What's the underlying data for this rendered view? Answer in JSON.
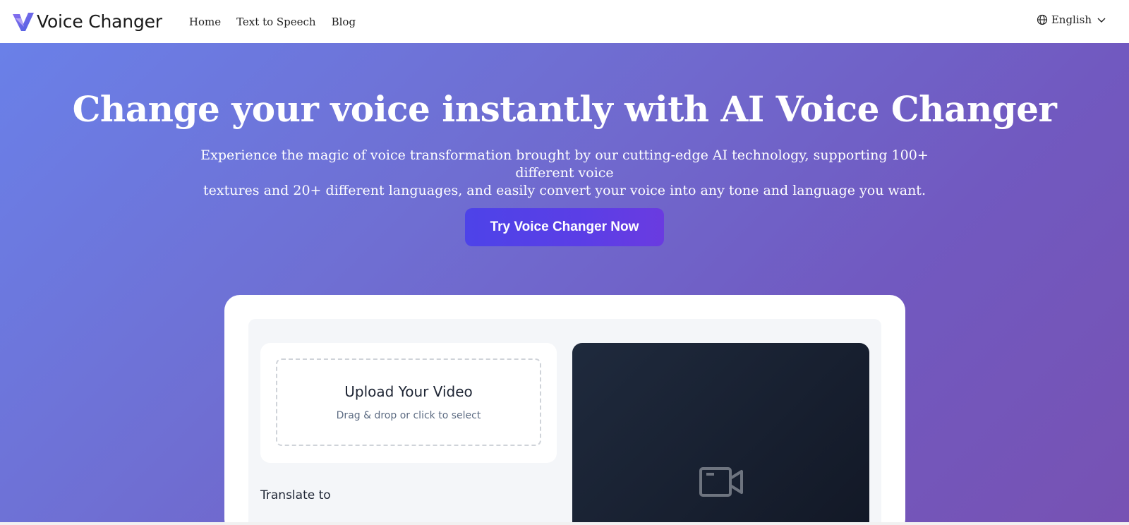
{
  "header": {
    "brand_name": "Voice Changer",
    "nav": [
      {
        "label": "Home"
      },
      {
        "label": "Text to Speech"
      },
      {
        "label": "Blog"
      }
    ],
    "language": "English"
  },
  "hero": {
    "title": "Change your voice instantly with AI Voice Changer",
    "subtitle_line1": "Experience the magic of voice transformation brought by our cutting-edge AI technology, supporting 100+ different voice",
    "subtitle_line2": "textures and 20+ different languages, and easily convert your voice into any tone and language you want.",
    "cta_label": "Try Voice Changer Now"
  },
  "tool": {
    "upload_title": "Upload Your Video",
    "upload_hint": "Drag & drop or click to select",
    "translate_label": "Translate to"
  },
  "icons": {
    "logo": "voice-changer-logo",
    "language": "globe-icon",
    "language_toggle": "chevron-down-icon",
    "video_placeholder": "video-camera-icon"
  },
  "colors": {
    "hero_gradient_start": "#6a80e8",
    "hero_gradient_end": "#7752b3",
    "cta_start": "#4d43e8",
    "cta_end": "#6a3be0",
    "preview_bg": "#1a2233"
  }
}
